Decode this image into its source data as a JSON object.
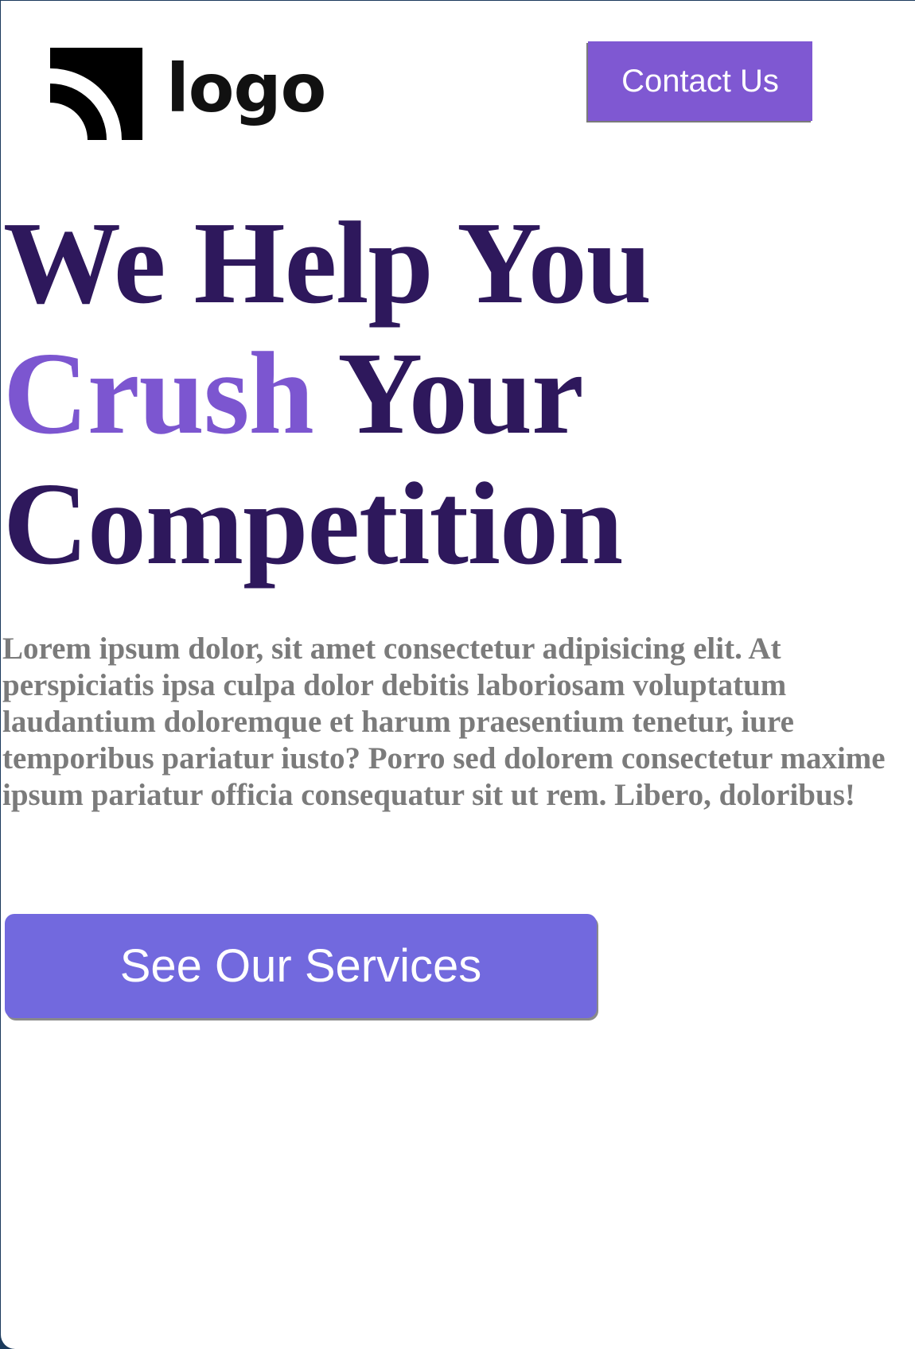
{
  "header": {
    "logo_text": "logo",
    "contact_label": "Contact Us"
  },
  "hero": {
    "headline_line1": "We Help You",
    "headline_accent": "Crush",
    "headline_line2_rest": " Your",
    "headline_line3": "Competition",
    "lead": "Lorem ipsum dolor, sit amet consectetur adipisicing elit. At perspiciatis ipsa culpa dolor debitis laboriosam voluptatum laudantium doloremque et harum praesentium tenetur, iure temporibus pariatur iusto? Porro sed dolorem consectetur maxime ipsum pariatur officia consequatur sit ut rem. Libero, doloribus!",
    "cta_label": "See Our Services"
  },
  "colors": {
    "headline": "#2e185c",
    "accent": "#7c56d0",
    "contact_button": "#7f58d2",
    "cta_button": "#7269de",
    "lead_text": "#7b7b7b"
  },
  "icons": {
    "logo_mark": "broadcast-arcs-icon"
  }
}
